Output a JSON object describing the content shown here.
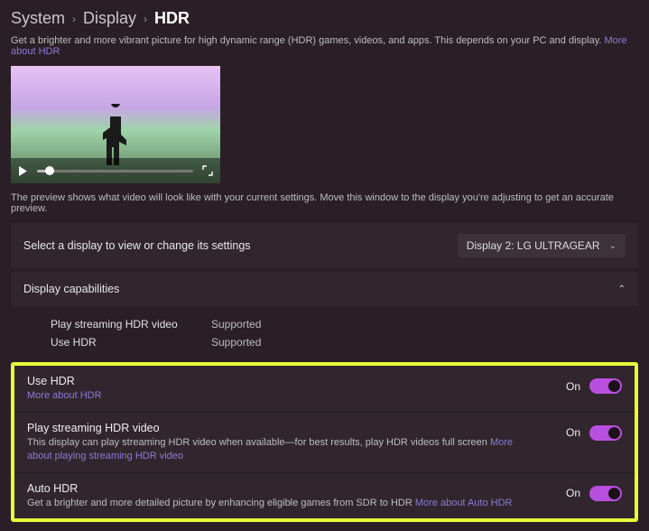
{
  "breadcrumb": {
    "level1": "System",
    "level2": "Display",
    "level3": "HDR"
  },
  "subtitle": {
    "text": "Get a brighter and more vibrant picture for high dynamic range (HDR) games, videos, and apps. This depends on your PC and display.",
    "link": "More about HDR"
  },
  "preview_caption": "The preview shows what video will look like with your current settings. Move this window to the display you're adjusting to get an accurate preview.",
  "display_selector": {
    "label": "Select a display to view or change its settings",
    "value": "Display 2: LG ULTRAGEAR"
  },
  "capabilities": {
    "heading": "Display capabilities",
    "rows": [
      {
        "name": "Play streaming HDR video",
        "value": "Supported"
      },
      {
        "name": "Use HDR",
        "value": "Supported"
      }
    ]
  },
  "settings": [
    {
      "title": "Use HDR",
      "desc": "",
      "link": "More about HDR",
      "state": "On"
    },
    {
      "title": "Play streaming HDR video",
      "desc": "This display can play streaming HDR video when available—for best results, play HDR videos full screen",
      "link": "More about playing streaming HDR video",
      "state": "On"
    },
    {
      "title": "Auto HDR",
      "desc": "Get a brighter and more detailed picture by enhancing eligible games from SDR to HDR",
      "link": "More about Auto HDR",
      "state": "On"
    }
  ]
}
